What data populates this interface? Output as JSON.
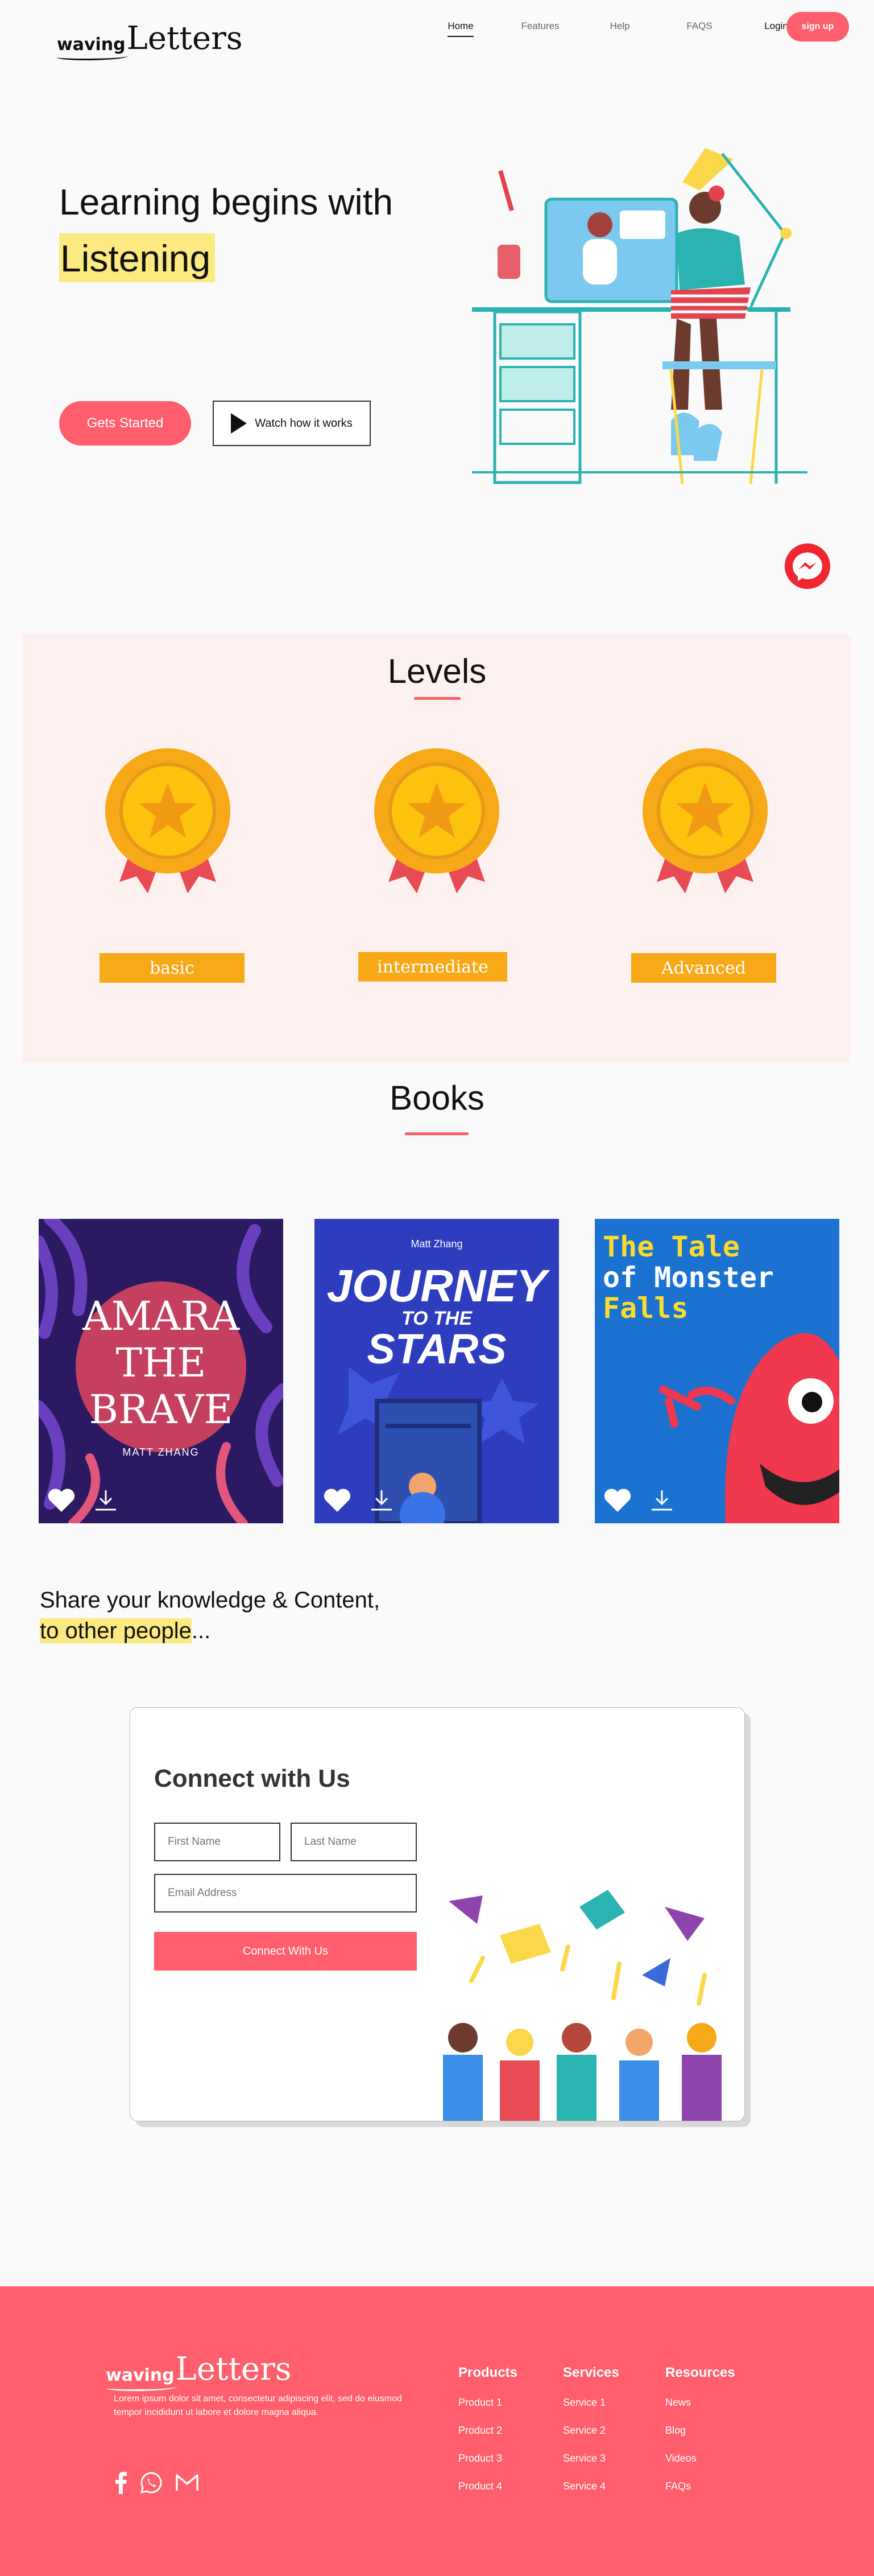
{
  "brand": {
    "logo_small": "waving",
    "logo_big": "Letters"
  },
  "nav": {
    "items": [
      {
        "label": "Home"
      },
      {
        "label": "Features"
      },
      {
        "label": "Help"
      },
      {
        "label": "FAQS"
      },
      {
        "label": "Login"
      }
    ],
    "signup_label": "sign up"
  },
  "hero": {
    "title": "Learning begins with",
    "highlight": "Listening",
    "primary_button": "Gets Started",
    "secondary_button": "Watch how it works"
  },
  "levels": {
    "title": "Levels",
    "items": [
      {
        "label": "basic"
      },
      {
        "label": "intermediate"
      },
      {
        "label": "Advanced"
      }
    ]
  },
  "books": {
    "title": "Books",
    "items": [
      {
        "title_lines": [
          "AMARA",
          "THE",
          "BRAVE"
        ],
        "author": "MATT ZHANG"
      },
      {
        "author": "Matt Zhang",
        "title_lines": [
          "JOURNEY",
          "TO THE",
          "STARS"
        ]
      },
      {
        "title_lines": [
          "The Tale",
          "of Monster",
          "Falls"
        ]
      }
    ]
  },
  "share": {
    "line1": "Share your knowledge & Content,",
    "line2_highlight": "to other people",
    "line2_rest": "..."
  },
  "connect": {
    "title": "Connect with Us",
    "first_name_placeholder": "First Name",
    "last_name_placeholder": "Last Name",
    "email_placeholder": "Email Address",
    "submit_label": "Connect With Us"
  },
  "footer": {
    "description": "Lorem ipsum dolor sit amet, consectetur adipiscing elit, sed do eiusmod tempor incididunt ut labore et dolore magna aliqua.",
    "columns": [
      {
        "title": "Products",
        "links": [
          "Product 1",
          "Product 2",
          "Product 3",
          "Product 4"
        ]
      },
      {
        "title": "Services",
        "links": [
          "Service 1",
          "Service 2",
          "Service 3",
          "Service 4"
        ]
      },
      {
        "title": "Resources",
        "links": [
          "News",
          "Blog",
          "Videos",
          "FAQs"
        ]
      }
    ]
  },
  "colors": {
    "accent": "#ff5e6c",
    "highlight": "#fce97f",
    "medal": "#f7a918",
    "levels_bg": "#fdf1f0"
  }
}
